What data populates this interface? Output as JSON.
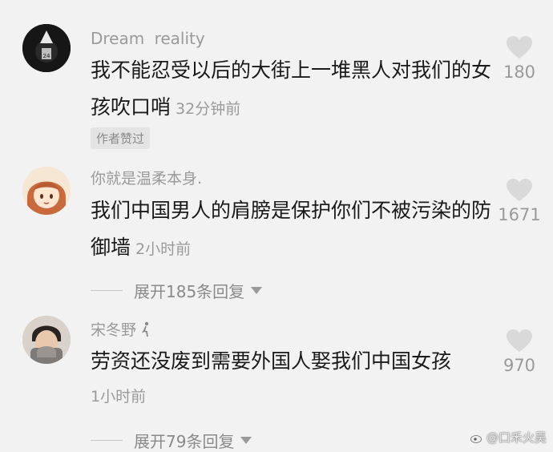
{
  "comments": [
    {
      "author": "Dream reality",
      "text": "我不能忍受以后的大街上一堆黑人对我们的女孩吹口哨",
      "time": "32分钟前",
      "likes": "180",
      "badge": "作者赞过"
    },
    {
      "author": "你就是温柔本身.",
      "text": "我们中国男人的肩膀是保护你们不被污染的防御墙",
      "time": "2小时前",
      "likes": "1671",
      "replies": "展开185条回复"
    },
    {
      "author": "宋冬野",
      "text": "劳资还没废到需要外国人娶我们中国女孩",
      "time": "1小时前",
      "likes": "970",
      "replies": "展开79条回复"
    }
  ],
  "watermark": "@口禾火吴"
}
